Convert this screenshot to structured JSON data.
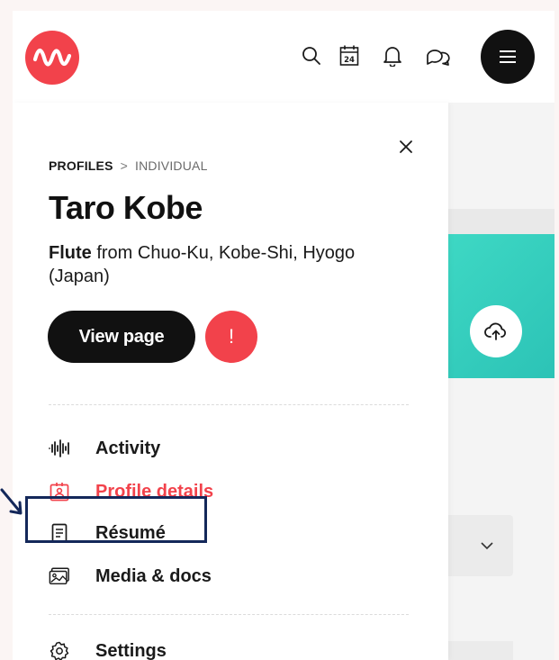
{
  "header": {
    "icons": [
      "logo-icon",
      "search-icon",
      "calendar-icon",
      "bell-icon",
      "chat-icon",
      "menu-icon"
    ],
    "calendar_day": "24"
  },
  "panel": {
    "breadcrumb": {
      "level1": "PROFILES",
      "separator": ">",
      "level2": "INDIVIDUAL"
    },
    "name": "Taro Kobe",
    "instrument": "Flute",
    "location_text": " from Chuo-Ku, Kobe-Shi, Hyogo (Japan)",
    "view_page_label": "View page",
    "alert_label": "!",
    "nav": [
      {
        "label": "Activity",
        "icon": "waveform-icon",
        "active": false
      },
      {
        "label": "Profile details",
        "icon": "id-badge-icon",
        "active": true
      },
      {
        "label": "Résumé",
        "icon": "document-icon",
        "active": false
      },
      {
        "label": "Media & docs",
        "icon": "media-icon",
        "active": false
      }
    ],
    "settings_label": "Settings"
  },
  "colors": {
    "accent": "#f2424b",
    "teal": "#3ed8c4",
    "dark": "#111111",
    "annotation": "#14285a"
  }
}
